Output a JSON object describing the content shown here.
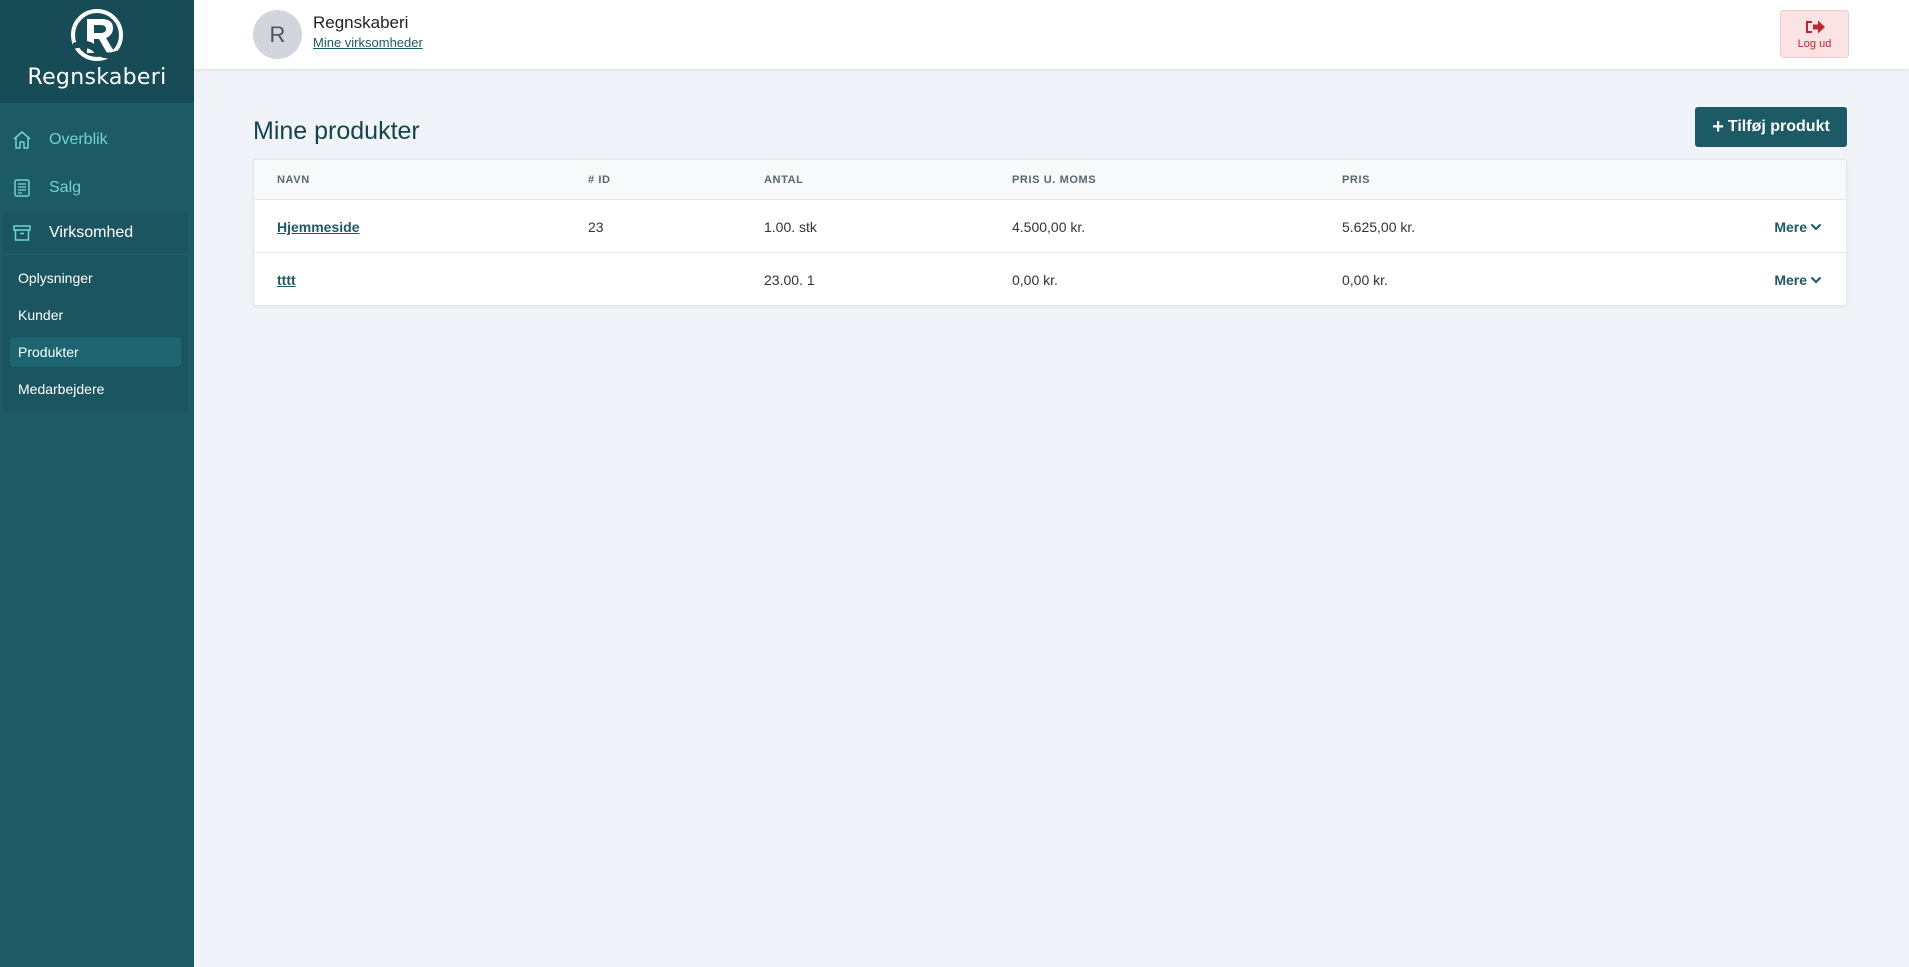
{
  "brand": {
    "name": "Regnskaberi"
  },
  "sidebar": {
    "nav": [
      {
        "label": "Overblik",
        "icon": "home-icon"
      },
      {
        "label": "Salg",
        "icon": "receipt-icon"
      },
      {
        "label": "Virksomhed",
        "icon": "archive-icon"
      }
    ],
    "sub_items": [
      {
        "label": "Oplysninger"
      },
      {
        "label": "Kunder"
      },
      {
        "label": "Produkter"
      },
      {
        "label": "Medarbejdere"
      }
    ]
  },
  "header": {
    "avatar_initial": "R",
    "company_name": "Regnskaberi",
    "company_link": "Mine virksomheder",
    "logout_label": "Log ud"
  },
  "main": {
    "title": "Mine produkter",
    "add_button_label": "Tilføj produkt",
    "table": {
      "columns": [
        "NAVN",
        "# ID",
        "ANTAL",
        "PRIS U. MOMS",
        "PRIS"
      ],
      "more_label": "Mere",
      "rows": [
        {
          "name": "Hjemmeside",
          "id": "23",
          "antal": "1.00. stk",
          "pris_u_moms": "4.500,00 kr.",
          "pris": "5.625,00 kr."
        },
        {
          "name": "tttt",
          "id": "",
          "antal": "23.00. 1",
          "pris_u_moms": "0,00 kr.",
          "pris": "0,00 kr."
        }
      ]
    }
  },
  "colors": {
    "sidebar": "#1c5a65",
    "accent": "#1c5a65",
    "danger": "#c0262d",
    "nav_text": "#6fd3d5"
  }
}
